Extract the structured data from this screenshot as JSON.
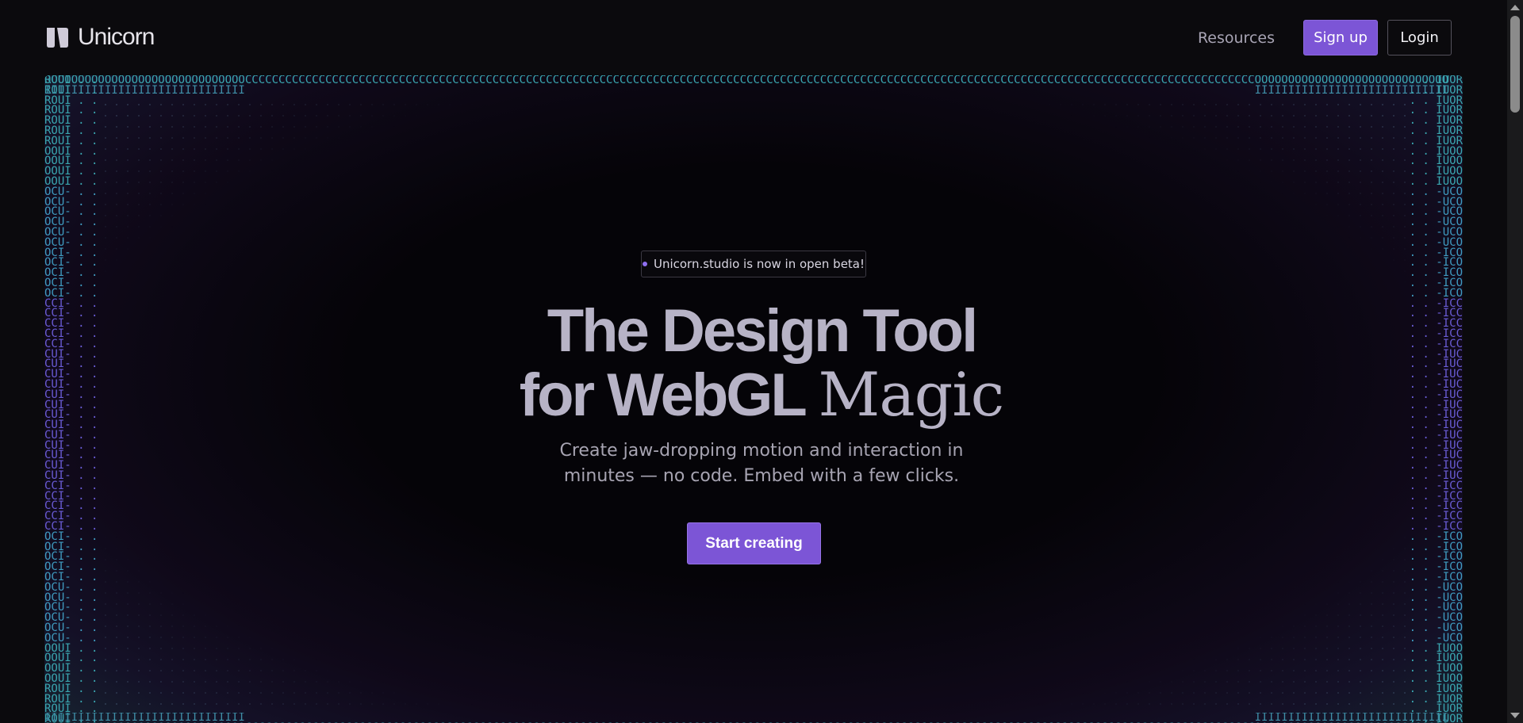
{
  "header": {
    "logo_text": "Unicorn",
    "nav": {
      "resources": "Resources",
      "signup": "Sign up",
      "login": "Login"
    }
  },
  "hero": {
    "badge": "Unicorn.studio is now in open beta!",
    "title_line1": "The Design Tool",
    "title_line2_a": "for WebGL ",
    "title_line2_b": "Magic",
    "subtitle": "Create jaw-dropping motion and interaction in minutes — no code. Embed with a few clicks.",
    "cta": "Start creating"
  },
  "colors": {
    "accent": "#7c55d6",
    "background": "#0b0a0d",
    "title": "#b7b3c6",
    "ascii_teal": "#3aa6b0",
    "ascii_purple": "#6a5cd6"
  },
  "icons": {
    "logo": "unicorn-logo-icon",
    "badge_dot": "status-dot-icon"
  }
}
